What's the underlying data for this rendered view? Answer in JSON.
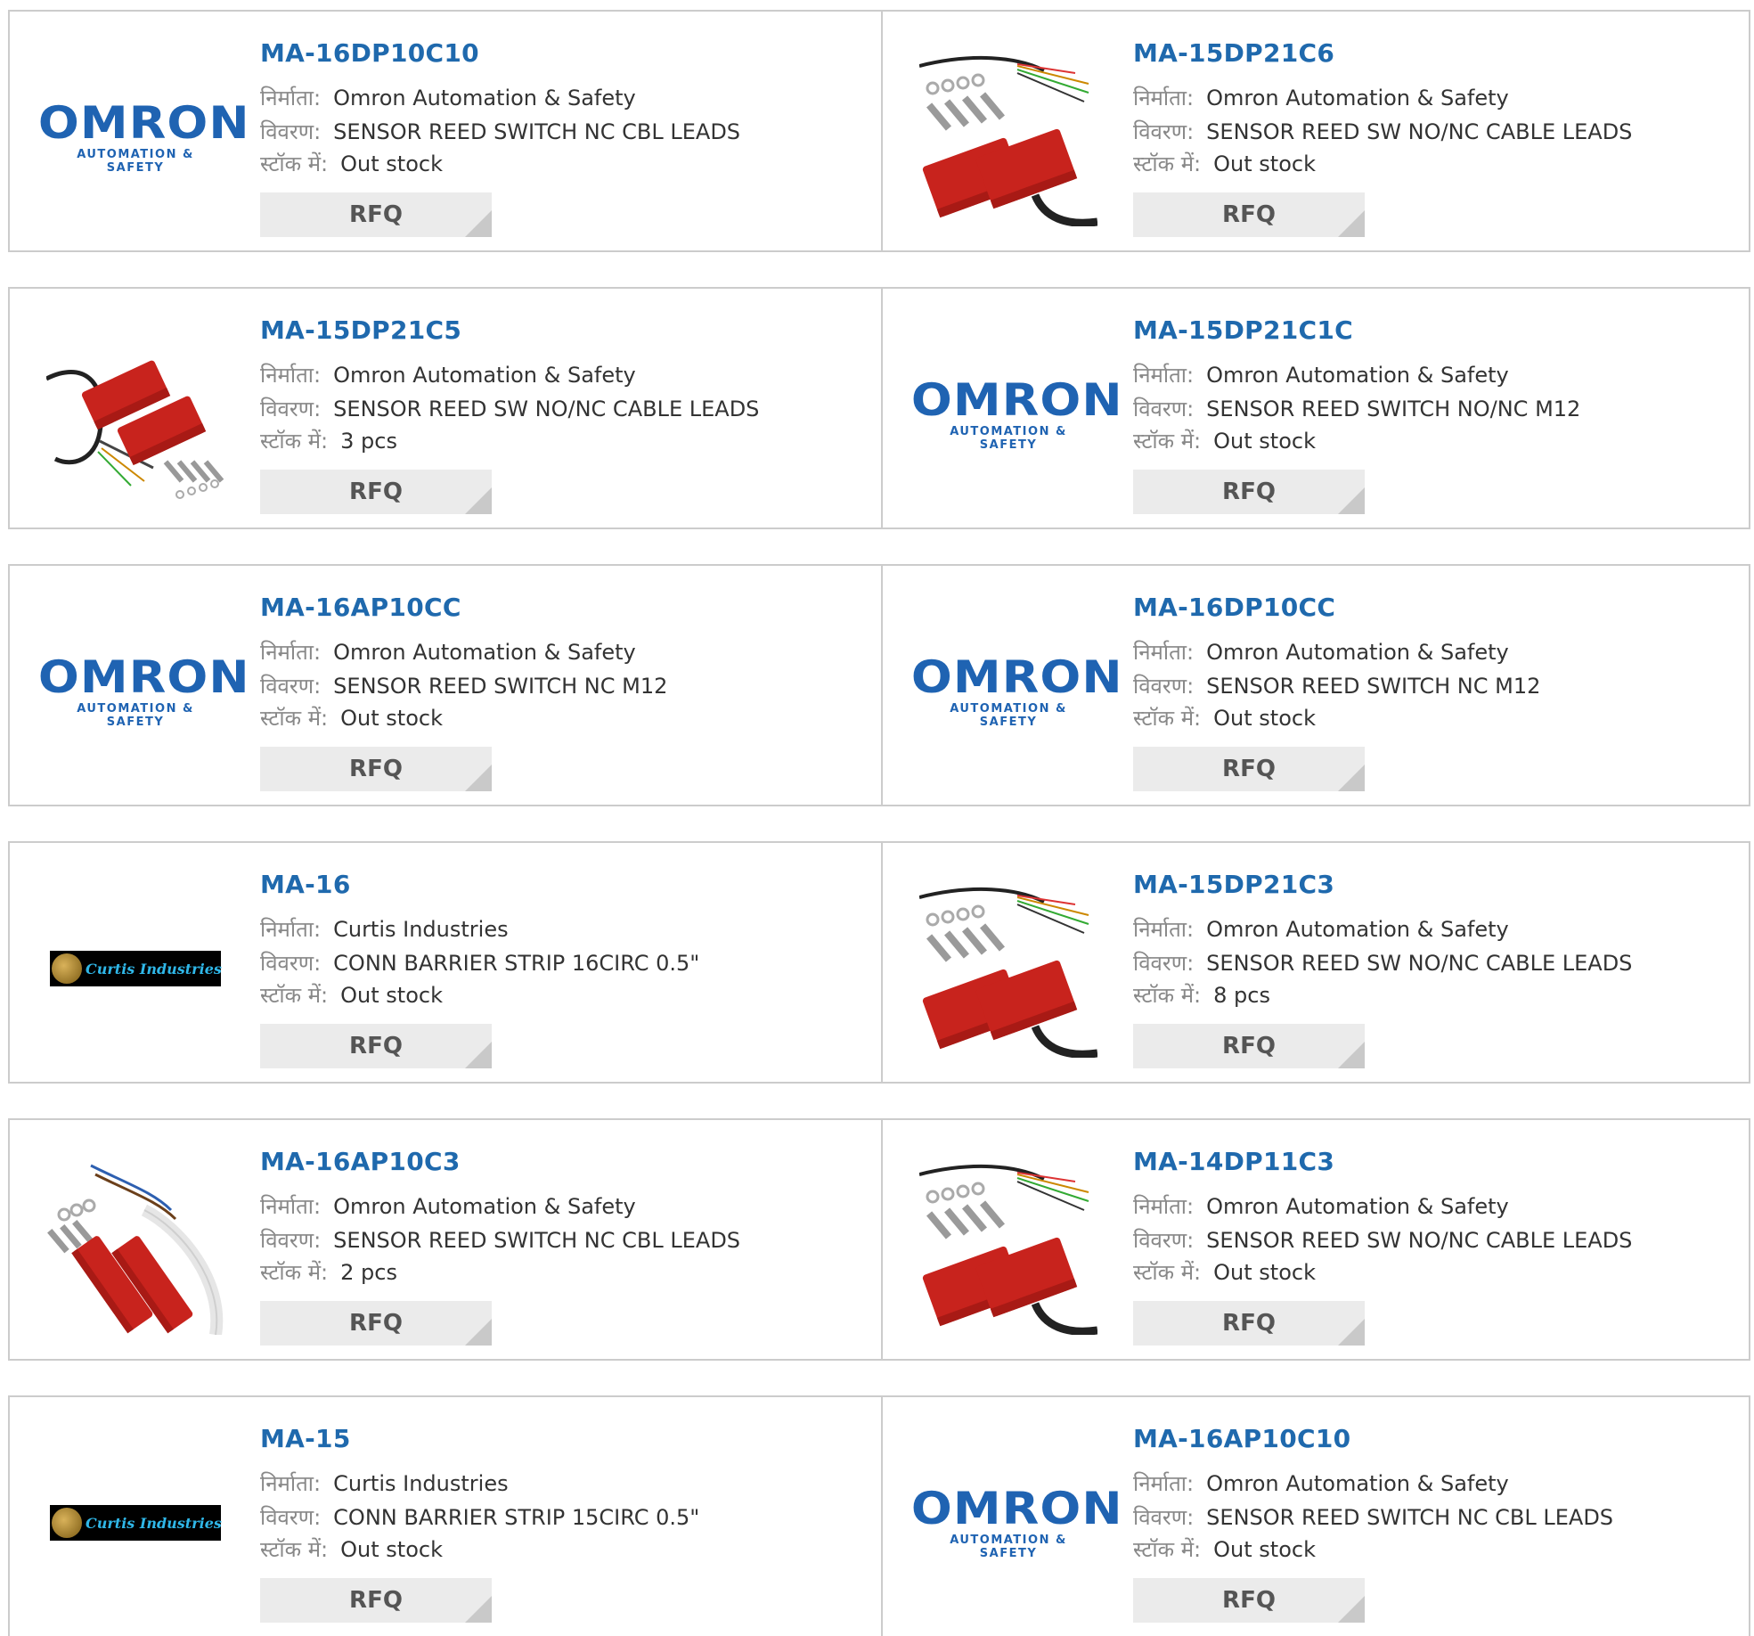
{
  "labels": {
    "manufacturer": "निर्माता:",
    "description": "विवरण:",
    "stock": "स्टॉक में:",
    "rfq": "RFQ"
  },
  "logos": {
    "omron": {
      "word": "OMRON",
      "tagline": "AUTOMATION & SAFETY"
    },
    "curtis": {
      "name": "Curtis Industries"
    }
  },
  "colors": {
    "title": "#1f69ad",
    "border": "#cccccc",
    "button_bg": "#ebebeb"
  },
  "products": [
    {
      "part": "MA-16DP10C10",
      "manufacturer": "Omron Automation & Safety",
      "description": "SENSOR REED SWITCH NC CBL LEADS",
      "stock": "Out stock",
      "image": "omron-logo"
    },
    {
      "part": "MA-15DP21C6",
      "manufacturer": "Omron Automation & Safety",
      "description": "SENSOR REED SW NO/NC CABLE LEADS",
      "stock": "Out stock",
      "image": "reed-switch-photo-cable-bottom"
    },
    {
      "part": "MA-15DP21C5",
      "manufacturer": "Omron Automation & Safety",
      "description": "SENSOR REED SW NO/NC CABLE LEADS",
      "stock": "3 pcs",
      "image": "reed-switch-photo-cable-top"
    },
    {
      "part": "MA-15DP21C1C",
      "manufacturer": "Omron Automation & Safety",
      "description": "SENSOR REED SWITCH NO/NC M12",
      "stock": "Out stock",
      "image": "omron-logo"
    },
    {
      "part": "MA-16AP10CC",
      "manufacturer": "Omron Automation & Safety",
      "description": "SENSOR REED SWITCH NC M12",
      "stock": "Out stock",
      "image": "omron-logo"
    },
    {
      "part": "MA-16DP10CC",
      "manufacturer": "Omron Automation & Safety",
      "description": "SENSOR REED SWITCH NC M12",
      "stock": "Out stock",
      "image": "omron-logo"
    },
    {
      "part": "MA-16",
      "manufacturer": "Curtis Industries",
      "description": "CONN BARRIER STRIP 16CIRC 0.5\"",
      "stock": "Out stock",
      "image": "curtis-logo"
    },
    {
      "part": "MA-15DP21C3",
      "manufacturer": "Omron Automation & Safety",
      "description": "SENSOR REED SW NO/NC CABLE LEADS",
      "stock": "8 pcs",
      "image": "reed-switch-photo-cable-bottom"
    },
    {
      "part": "MA-16AP10C3",
      "manufacturer": "Omron Automation & Safety",
      "description": "SENSOR REED SWITCH NC CBL LEADS",
      "stock": "2 pcs",
      "image": "reed-switch-photo-white-cable"
    },
    {
      "part": "MA-14DP11C3",
      "manufacturer": "Omron Automation & Safety",
      "description": "SENSOR REED SW NO/NC CABLE LEADS",
      "stock": "Out stock",
      "image": "reed-switch-photo-cable-bottom"
    },
    {
      "part": "MA-15",
      "manufacturer": "Curtis Industries",
      "description": "CONN BARRIER STRIP 15CIRC 0.5\"",
      "stock": "Out stock",
      "image": "curtis-logo"
    },
    {
      "part": "MA-16AP10C10",
      "manufacturer": "Omron Automation & Safety",
      "description": "SENSOR REED SWITCH NC CBL LEADS",
      "stock": "Out stock",
      "image": "omron-logo"
    }
  ]
}
